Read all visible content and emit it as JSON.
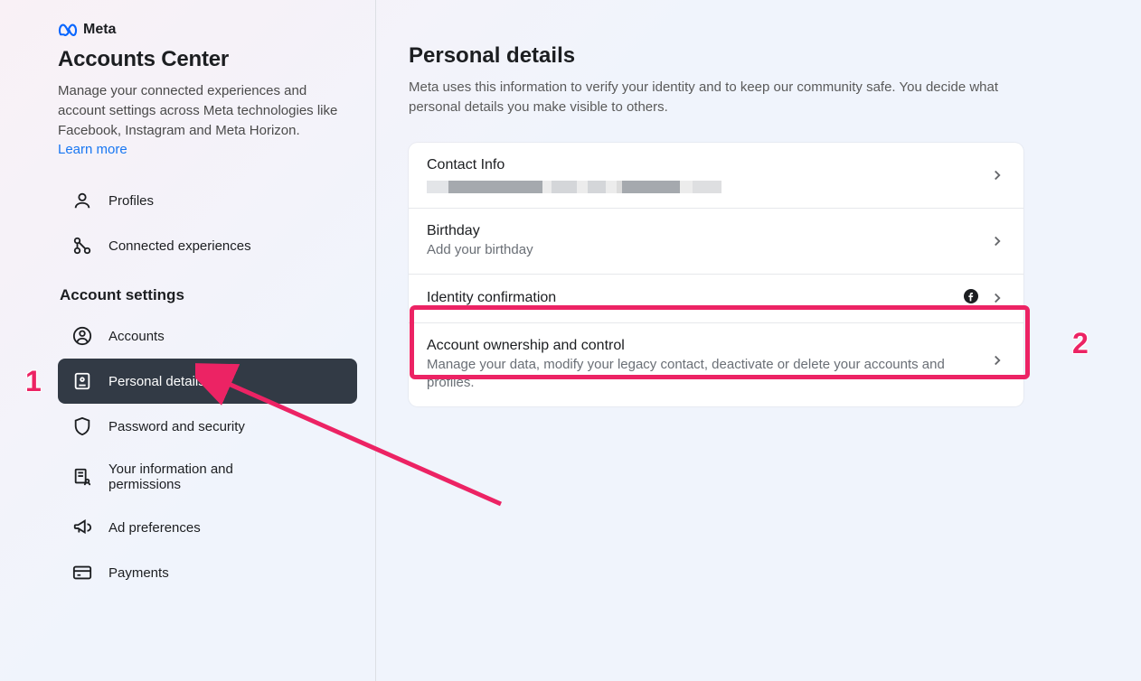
{
  "brand": {
    "name": "Meta"
  },
  "sidebar": {
    "title": "Accounts Center",
    "description": "Manage your connected experiences and account settings across Meta technologies like Facebook, Instagram and Meta Horizon.",
    "learn_more": "Learn more",
    "nav_top": {
      "profiles": "Profiles",
      "connected": "Connected experiences"
    },
    "section_heading": "Account settings",
    "nav_settings": {
      "accounts": "Accounts",
      "personal_details": "Personal details",
      "password_security": "Password and security",
      "info_permissions": "Your information and permissions",
      "ad_preferences": "Ad preferences",
      "payments": "Payments"
    }
  },
  "main": {
    "heading": "Personal details",
    "description": "Meta uses this information to verify your identity and to keep our community safe. You decide what personal details you make visible to others.",
    "rows": {
      "contact_info": {
        "title": "Contact Info"
      },
      "birthday": {
        "title": "Birthday",
        "sub": "Add your birthday"
      },
      "identity": {
        "title": "Identity confirmation"
      },
      "ownership": {
        "title": "Account ownership and control",
        "sub": "Manage your data, modify your legacy contact, deactivate or delete your accounts and profiles."
      }
    }
  },
  "annotations": {
    "one": "1",
    "two": "2"
  }
}
